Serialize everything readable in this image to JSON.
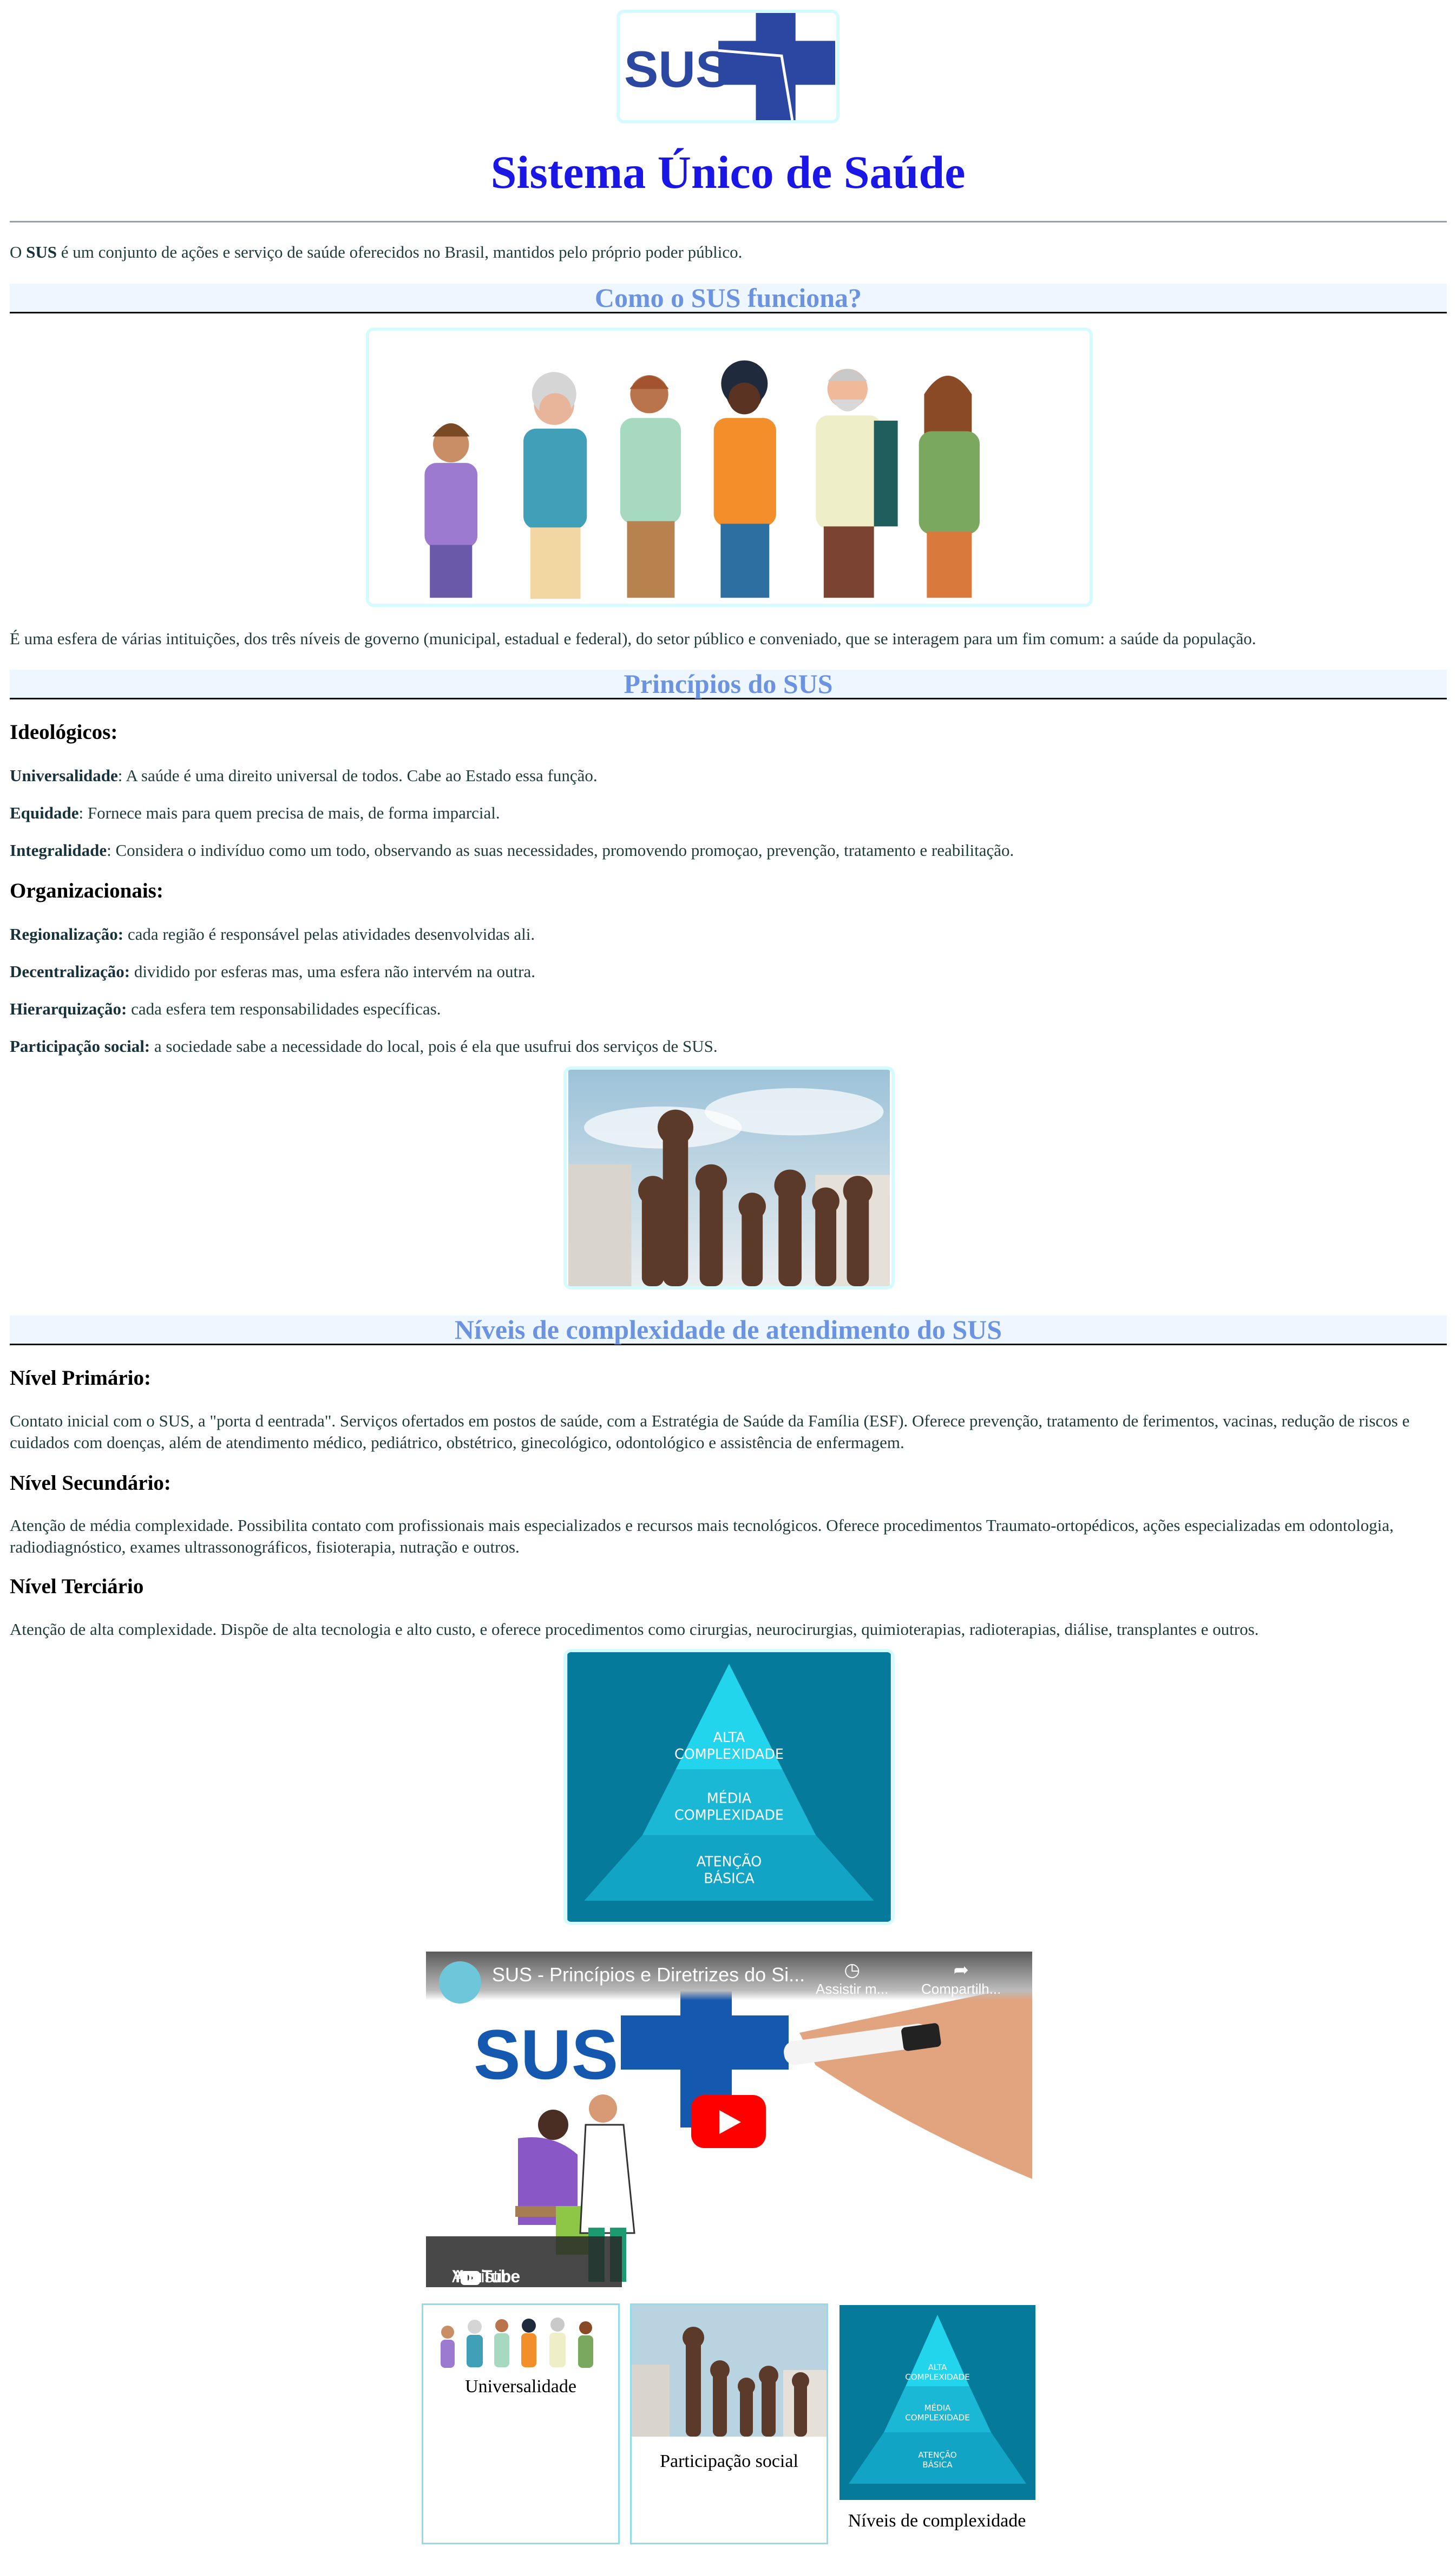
{
  "header": {
    "logo_text": "SUS",
    "title": "Sistema Único de Saúde"
  },
  "intro": {
    "prefix": "O ",
    "strong": "SUS",
    "rest": " é um conjunto de ações e serviço de saúde oferecidos no Brasil, mantidos pelo próprio poder público."
  },
  "section1": {
    "heading": "Como o SUS funciona?",
    "paragraph": "É uma esfera de várias intituições, dos três níveis de governo (municipal, estadual e federal), do setor público e conveniado, que se interagem para um fim comum: a saúde da população."
  },
  "section2": {
    "heading": "Princípios do SUS",
    "ideologicos_title": "Ideológicos:",
    "ideologicos": [
      {
        "term": "Universalidade",
        "text": ": A saúde é uma direito universal de todos. Cabe ao Estado essa função."
      },
      {
        "term": "Equidade",
        "text": ": Fornece mais para quem precisa de mais, de forma imparcial."
      },
      {
        "term": "Integralidade",
        "text": ": Considera o indivíduo como um todo, observando as suas necessidades, promovendo promoçao, prevenção, tratamento e reabilitação."
      }
    ],
    "organizacionais_title": "Organizacionais:",
    "organizacionais": [
      {
        "term": "Regionalização:",
        "text": " cada região é responsável pelas atividades desenvolvidas ali."
      },
      {
        "term": "Decentralização:",
        "text": " dividido por esferas mas, uma esfera não intervém na outra."
      },
      {
        "term": "Hierarquização:",
        "text": " cada esfera tem responsabilidades específicas."
      },
      {
        "term": "Participação social:",
        "text": " a sociedade sabe a necessidade do local, pois é ela que usufrui dos serviços de SUS."
      }
    ]
  },
  "section3": {
    "heading": "Níveis de complexidade de atendimento do SUS",
    "levels": [
      {
        "title": "Nível Primário:",
        "text": "Contato inicial com o SUS, a \"porta d eentrada\". Serviços ofertados em postos de saúde, com a Estratégia de Saúde da Família (ESF). Oferece prevenção, tratamento de ferimentos, vacinas, redução de riscos e cuidados com doenças, além de atendimento médico, pediátrico, obstétrico, ginecológico, odontológico e assistência de enfermagem."
      },
      {
        "title": "Nível Secundário:",
        "text": "Atenção de média complexidade. Possibilita contato com profissionais mais especializados e recursos mais tecnológicos. Oferece procedimentos Traumato-ortopédicos, ações especializadas em odontologia, radiodiagnóstico, exames ultrassonográficos, fisioterapia, nutração e outros."
      },
      {
        "title": "Nível Terciário",
        "text": "Atenção de alta complexidade. Dispõe de alta tecnologia e alto custo, e oferece procedimentos como cirurgias, neurocirurgias, quimioterapias, radioterapias, diálise, transplantes e outros."
      }
    ],
    "pyramid": [
      "ALTA",
      "COMPLEXIDADE",
      "MÉDIA",
      "COMPLEXIDADE",
      "ATENÇÃO",
      "BÁSICA"
    ]
  },
  "video": {
    "title": "SUS - Princípios e Diretrizes do Si...",
    "watch_later": "Assistir m...",
    "share": "Compartilh...",
    "watch_on": "Assistir no",
    "platform": "YouTube",
    "logo_text": "SUS"
  },
  "cards": [
    {
      "caption": "Universalidade"
    },
    {
      "caption": "Participação social"
    },
    {
      "caption": "Níveis de complexidade"
    }
  ],
  "colors": {
    "title": "#1a16e6",
    "section_heading": "#6b93df",
    "section_bg": "#eef7ff",
    "sus_blue": "#2b47a1",
    "pyramid_bg": "#067a9a",
    "frame": "#d6fbff"
  }
}
